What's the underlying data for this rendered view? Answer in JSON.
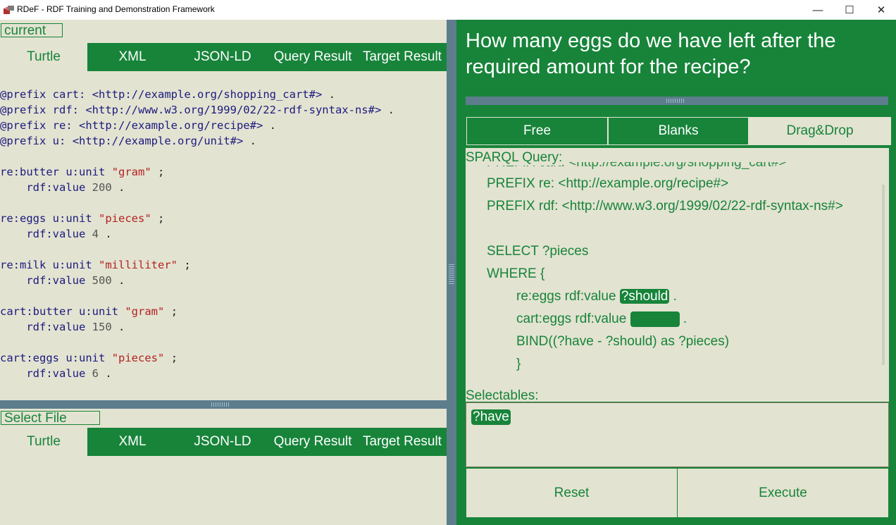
{
  "window": {
    "title": "RDeF - RDF Training and Demonstration Framework",
    "minimize_glyph": "—",
    "maximize_glyph": "☐",
    "close_glyph": "✕"
  },
  "top_pane": {
    "file_label": "current",
    "tabs": [
      "Turtle",
      "XML",
      "JSON-LD",
      "Query Result",
      "Target Result"
    ],
    "active_tab": "Turtle"
  },
  "bottom_pane": {
    "file_label": "Select File",
    "tabs": [
      "Turtle",
      "XML",
      "JSON-LD",
      "Query Result",
      "Target Result"
    ],
    "active_tab": "Turtle"
  },
  "turtle": {
    "prefixes": [
      {
        "kw": "@prefix",
        "name": "cart:",
        "uri": "<http://example.org/shopping_cart#>",
        "end": "."
      },
      {
        "kw": "@prefix",
        "name": "rdf:",
        "uri": "<http://www.w3.org/1999/02/22-rdf-syntax-ns#>",
        "end": "."
      },
      {
        "kw": "@prefix",
        "name": "re:",
        "uri": "<http://example.org/recipe#>",
        "end": "."
      },
      {
        "kw": "@prefix",
        "name": "u:",
        "uri": "<http://example.org/unit#>",
        "end": "."
      }
    ],
    "triples": [
      {
        "subject": "re:butter",
        "pred1": "u:unit",
        "obj1": "\"gram\"",
        "sep1": ";",
        "pred2": "rdf:value",
        "obj2": "200",
        "sep2": "."
      },
      {
        "subject": "re:eggs",
        "pred1": "u:unit",
        "obj1": "\"pieces\"",
        "sep1": ";",
        "pred2": "rdf:value",
        "obj2": "4",
        "sep2": "."
      },
      {
        "subject": "re:milk",
        "pred1": "u:unit",
        "obj1": "\"milliliter\"",
        "sep1": ";",
        "pred2": "rdf:value",
        "obj2": "500",
        "sep2": "."
      },
      {
        "subject": "cart:butter",
        "pred1": "u:unit",
        "obj1": "\"gram\"",
        "sep1": ";",
        "pred2": "rdf:value",
        "obj2": "150",
        "sep2": "."
      },
      {
        "subject": "cart:eggs",
        "pred1": "u:unit",
        "obj1": "\"pieces\"",
        "sep1": ";",
        "pred2": "rdf:value",
        "obj2": "6",
        "sep2": "."
      }
    ]
  },
  "question": "How many eggs do we have left after the required amount for the recipe?",
  "mode_tabs": [
    "Free",
    "Blanks",
    "Drag&Drop"
  ],
  "active_mode": "Drag&Drop",
  "query": {
    "label": "SPARQL Query:",
    "cut_line": "PREFIX  cart:  <http://example.org/shopping_cart#>",
    "prefix1": "PREFIX  re:  <http://example.org/recipe#>",
    "prefix2": "PREFIX  rdf:  <http://www.w3.org/1999/02/22-rdf-syntax-ns#>",
    "select": "SELECT  ?pieces",
    "where": "WHERE  {",
    "line1_prefix": "re:eggs  rdf:value",
    "line1_var": "?should",
    "line1_end": ".",
    "line2_prefix": "cart:eggs  rdf:value",
    "line2_end": ".",
    "bind": "BIND((?have  -  ?should)  as  ?pieces)",
    "close": "}"
  },
  "selectables": {
    "label": "Selectables:",
    "items": [
      "?have"
    ]
  },
  "buttons": {
    "reset": "Reset",
    "execute": "Execute"
  },
  "colors": {
    "green": "#17843a",
    "panel": "#e3e3d1",
    "splitter": "#5d7d8d"
  }
}
